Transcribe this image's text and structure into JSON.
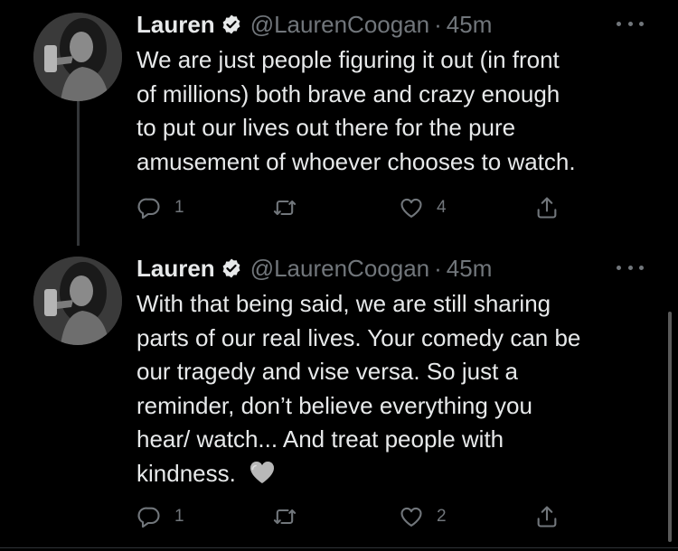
{
  "colors": {
    "background": "#000000",
    "text_primary": "#e7e9ea",
    "text_secondary": "#71767b",
    "verified_badge": "#e7e9ea"
  },
  "tweets": [
    {
      "author": {
        "name": "Lauren",
        "handle": "@LaurenCoogan",
        "verified_icon": "verified-badge-icon"
      },
      "separator": "·",
      "time": "45m",
      "text": "We are just people figuring it out (in front\nof millions) both brave and crazy enough\nto put our lives out there for the pure\namusement of whoever chooses to watch.",
      "actions": {
        "reply_count": "1",
        "retweet_count": "",
        "like_count": "4"
      }
    },
    {
      "author": {
        "name": "Lauren",
        "handle": "@LaurenCoogan",
        "verified_icon": "verified-badge-icon"
      },
      "separator": "·",
      "time": "45m",
      "text": "With that being said, we are still sharing\nparts of our real lives. Your comedy can be\nour tragedy and vise versa. So just a\nreminder, don’t believe everything you\nhear/ watch... And treat people with\nkindness.",
      "emoji": "grey-heart-emoji",
      "actions": {
        "reply_count": "1",
        "retweet_count": "",
        "like_count": "2"
      }
    }
  ]
}
